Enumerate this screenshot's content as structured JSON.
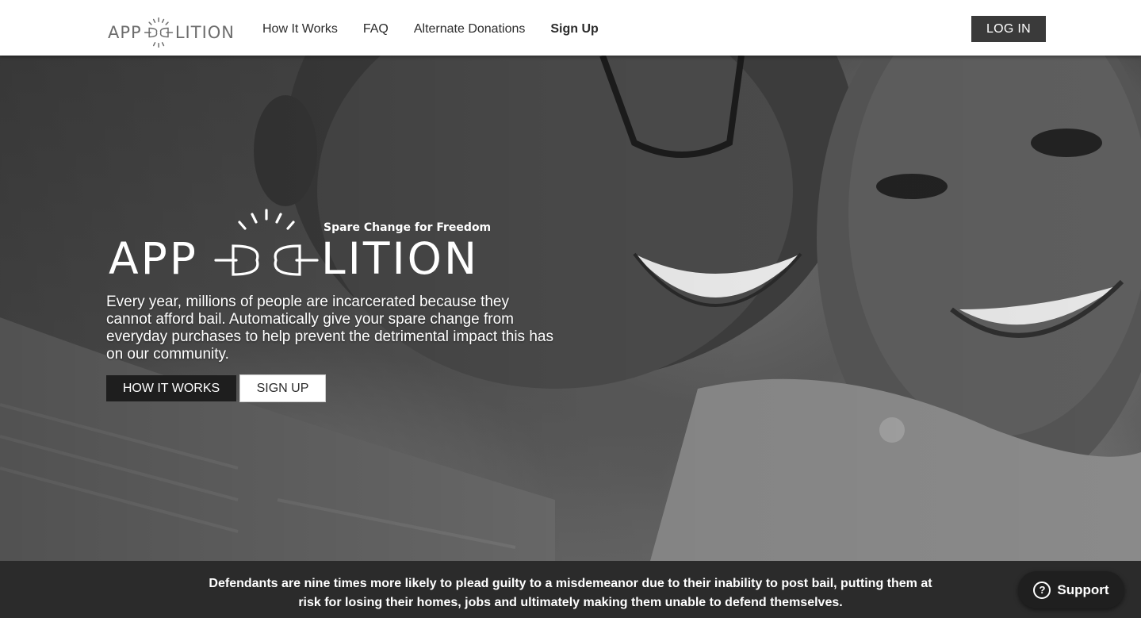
{
  "header": {
    "logo": {
      "left_text": "APP",
      "right_text": "LITION"
    },
    "nav": [
      {
        "label": "How It Works",
        "bold": false
      },
      {
        "label": "FAQ",
        "bold": false
      },
      {
        "label": "Alternate Donations",
        "bold": false
      },
      {
        "label": "Sign Up",
        "bold": true
      }
    ],
    "login_label": "LOG IN"
  },
  "hero": {
    "tagline": "Spare Change for Freedom",
    "brand_left": "APP",
    "brand_right": "LITION",
    "description": "Every year, millions of people are incarcerated because they cannot afford bail. Automatically give your spare change from everyday purchases to help prevent the detrimental impact this has on our community.",
    "how_it_works_label": "HOW IT WORKS",
    "sign_up_label": "SIGN UP"
  },
  "banner": {
    "text": "Defendants are nine times more likely to plead guilty to a misdemeanor due to their inability to post bail, putting them at risk for losing their homes, jobs and ultimately making them unable to defend themselves."
  },
  "support": {
    "label": "Support",
    "icon": "question-circle-icon"
  },
  "colors": {
    "header_bg": "#ffffff",
    "login_button_bg": "#3a3a3a",
    "how_button_bg": "#1e1e1e",
    "banner_bg": "#2b2b2b",
    "logo_gray": "#6d6d6d"
  }
}
